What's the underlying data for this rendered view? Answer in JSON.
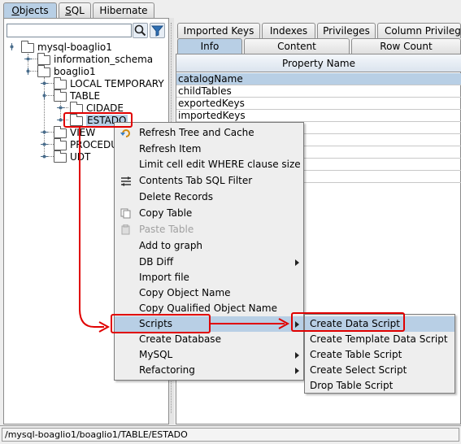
{
  "top_tabs": [
    {
      "label": "Objects",
      "mnemonic": "O",
      "rest": "bjects",
      "selected": true
    },
    {
      "label": "SQL",
      "mnemonic": "S",
      "rest": "QL",
      "selected": false
    },
    {
      "label": "Hibernate",
      "selected": false
    }
  ],
  "object_tree": {
    "filter_value": "",
    "root": "mysql-boaglio1",
    "nodes": [
      "information_schema",
      "boaglio1",
      "LOCAL TEMPORARY",
      "TABLE",
      "CIDADE",
      "ESTADO",
      "VIEW",
      "PROCEDURE",
      "UDT"
    ]
  },
  "detail_tabs": {
    "row1": [
      "Imported Keys",
      "Indexes",
      "Privileges",
      "Column Privileges"
    ],
    "row2": [
      "Info",
      "Content",
      "Row Count"
    ],
    "selected": "Info"
  },
  "property_table": {
    "header": "Property Name",
    "rows": [
      "catalogName",
      "childTables",
      "exportedKeys",
      "importedKeys"
    ]
  },
  "context_menu": {
    "items": [
      {
        "label": "Refresh Tree and Cache",
        "icon": "refresh-icon"
      },
      {
        "label": "Refresh Item"
      },
      {
        "label": "Limit cell edit WHERE clause size"
      },
      {
        "label": "Contents Tab SQL Filter",
        "icon": "filter-icon"
      },
      {
        "label": "Delete Records"
      },
      {
        "label": "Copy Table",
        "icon": "copy-icon"
      },
      {
        "label": "Paste Table",
        "icon": "paste-icon",
        "disabled": true
      },
      {
        "label": "Add to graph"
      },
      {
        "label": "DB Diff",
        "submenu": true
      },
      {
        "label": "Import file"
      },
      {
        "label": "Copy Object Name"
      },
      {
        "label": "Copy Qualified Object Name"
      },
      {
        "label": "Scripts",
        "submenu": true,
        "selected": true
      },
      {
        "label": "Create Database"
      },
      {
        "label": "MySQL",
        "submenu": true
      },
      {
        "label": "Refactoring",
        "submenu": true
      }
    ]
  },
  "scripts_submenu": {
    "items": [
      {
        "label": "Create Data Script",
        "selected": true
      },
      {
        "label": "Create Template Data Script"
      },
      {
        "label": "Create Table Script"
      },
      {
        "label": "Create Select Script"
      },
      {
        "label": "Drop Table Script"
      }
    ]
  },
  "status_bar": {
    "path": "/mysql-boaglio1/boaglio1/TABLE/ESTADO"
  },
  "colors": {
    "selection": "#b8cfe5",
    "annotation": "#e00000",
    "panel": "#eeeeee"
  }
}
